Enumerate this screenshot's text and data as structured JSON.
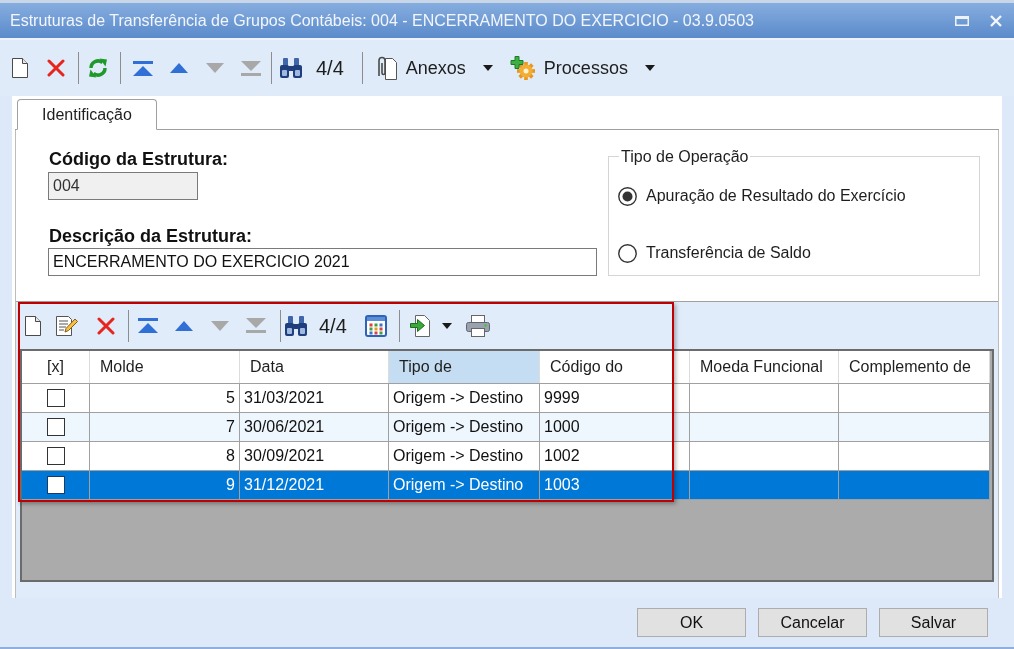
{
  "window": {
    "title": "Estruturas de Transferência de Grupos Contábeis: 004 - ENCERRAMENTO DO EXERCICIO - 03.9.0503"
  },
  "toolbar": {
    "navigation": [
      {
        "kind": "first",
        "disabled": false
      },
      {
        "kind": "previous",
        "disabled": false
      },
      {
        "kind": "next",
        "disabled": true
      },
      {
        "kind": "last",
        "disabled": true
      }
    ],
    "record_counter": "4/4",
    "menus": [
      {
        "kind": "attachments",
        "label": "Anexos"
      },
      {
        "kind": "processes",
        "label": "Processos"
      }
    ]
  },
  "tabs": [
    {
      "label": "Identificação",
      "selected": true
    }
  ],
  "form": {
    "fields": [
      {
        "label": "Código da Estrutura:",
        "value": "004",
        "disabled": true
      },
      {
        "label": "Descrição da Estrutura:",
        "value": "ENCERRAMENTO DO EXERCICIO 2021",
        "disabled": false
      }
    ],
    "operation_type": {
      "title": "Tipo de Operação",
      "options": [
        {
          "label": "Apuração de Resultado do Exercício",
          "selected": true
        },
        {
          "label": "Transferência de Saldo",
          "selected": false
        }
      ]
    }
  },
  "grid": {
    "toolbar": {
      "navigation": [
        {
          "kind": "first",
          "disabled": false
        },
        {
          "kind": "previous",
          "disabled": false
        },
        {
          "kind": "next",
          "disabled": true
        },
        {
          "kind": "last",
          "disabled": true
        }
      ],
      "record_counter": "4/4"
    },
    "check_column": {
      "label": "[x]"
    },
    "columns": [
      {
        "label": "Molde",
        "selected": false
      },
      {
        "label": "Data",
        "selected": false
      },
      {
        "label": "Tipo de",
        "selected": true
      },
      {
        "label": "Código do",
        "selected": false
      },
      {
        "label": "Moeda Funcional",
        "selected": false
      },
      {
        "label": "Complemento de",
        "selected": false
      }
    ],
    "rows": [
      {
        "checked": false,
        "selected": false,
        "cells": [
          "5",
          "31/03/2021",
          "Origem -> Destino",
          "9999"
        ]
      },
      {
        "checked": false,
        "selected": false,
        "cells": [
          "7",
          "30/06/2021",
          "Origem -> Destino",
          "1000"
        ]
      },
      {
        "checked": false,
        "selected": false,
        "cells": [
          "8",
          "30/09/2021",
          "Origem -> Destino",
          "1002"
        ]
      },
      {
        "checked": false,
        "selected": true,
        "cells": [
          "9",
          "31/12/2021",
          "Origem -> Destino",
          "1003"
        ]
      }
    ]
  },
  "buttons": [
    {
      "label": "OK"
    },
    {
      "label": "Cancelar"
    },
    {
      "label": "Salvar"
    }
  ]
}
